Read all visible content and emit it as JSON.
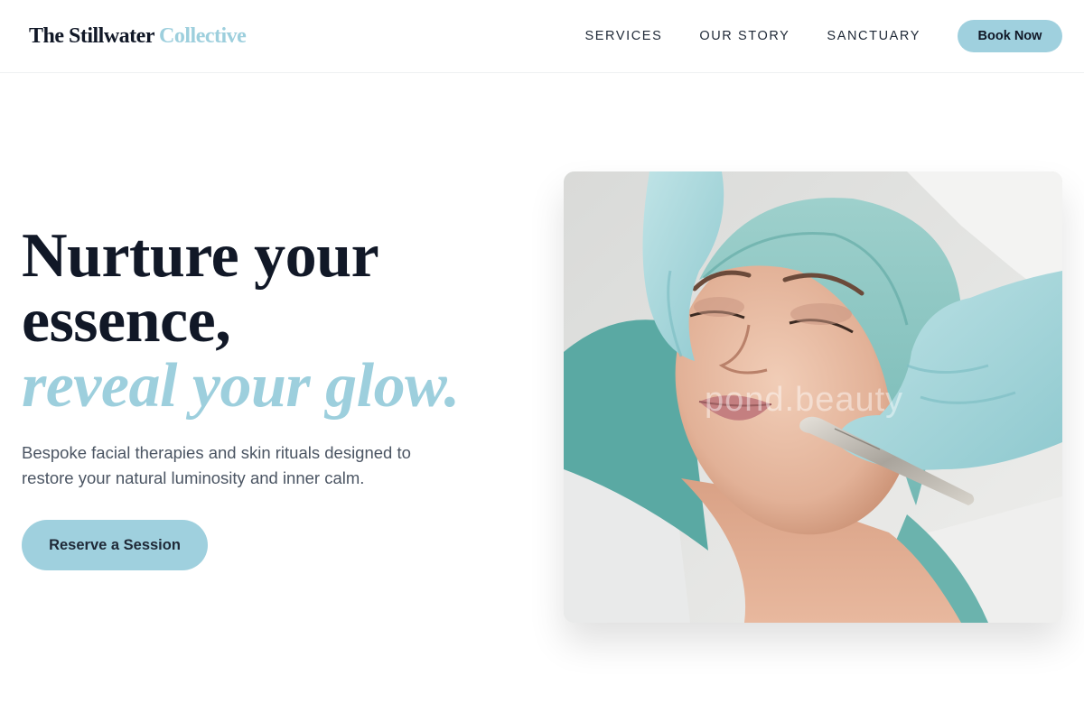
{
  "header": {
    "logo_main": "The Stillwater",
    "logo_accent": "Collective",
    "nav": [
      {
        "label": "SERVICES"
      },
      {
        "label": "OUR STORY"
      },
      {
        "label": "SANCTUARY"
      }
    ],
    "book_label": "Book Now"
  },
  "hero": {
    "headline_line1": "Nurture your",
    "headline_line2": "essence,",
    "headline_accent": "reveal your glow.",
    "subtext": "Bespoke facial therapies and skin rituals designed to restore your natural luminosity and inner calm.",
    "cta_label": "Reserve a Session",
    "image_watermark": "pond.beauty"
  },
  "colors": {
    "accent": "#9dcfdd",
    "button": "#9fd0de",
    "heading": "#111827",
    "body_text": "#4b5563"
  }
}
